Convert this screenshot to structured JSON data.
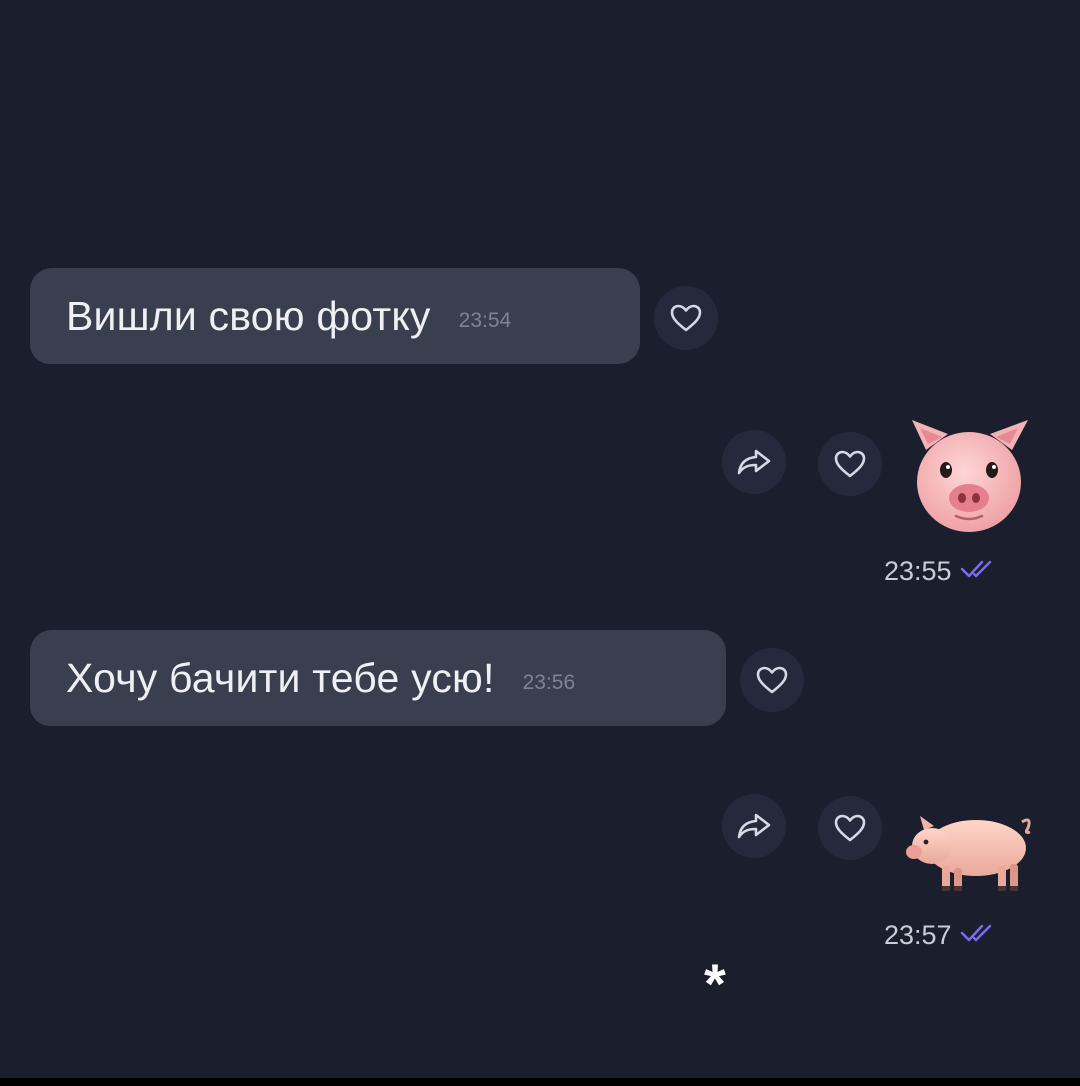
{
  "chat": {
    "messages": [
      {
        "direction": "incoming",
        "kind": "text",
        "text": "Вишли свою фотку",
        "time": "23:54"
      },
      {
        "direction": "outgoing",
        "kind": "sticker",
        "sticker": "pig-face-emoji",
        "time": "23:55",
        "status": "read-double-check-icon"
      },
      {
        "direction": "incoming",
        "kind": "text",
        "text": "Хочу бачити тебе усю!",
        "time": "23:56"
      },
      {
        "direction": "outgoing",
        "kind": "sticker",
        "sticker": "pig-emoji",
        "time": "23:57",
        "status": "read-double-check-icon"
      }
    ]
  },
  "icons": {
    "like": "heart-icon",
    "share": "share-arrow-icon",
    "read": "double-check-icon"
  },
  "overlay": {
    "mark": "*"
  },
  "colors": {
    "background": "#1b1f2d",
    "incoming_bubble": "#3a3f50",
    "round_button": "#242a3b",
    "read_check": "#7b6cf0"
  }
}
